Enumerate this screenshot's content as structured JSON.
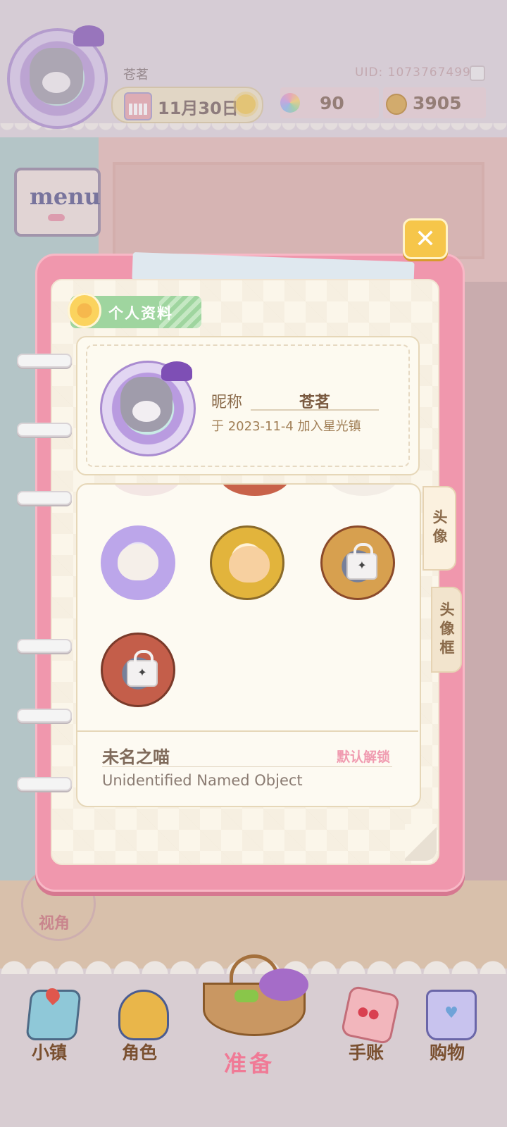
{
  "top_bar": {
    "player_name": "苍茗",
    "date": "11月30日",
    "uid": "UID: 1073767499",
    "gems": "90",
    "coins": "3905"
  },
  "menu": {
    "label": "menu"
  },
  "close": {
    "label": "✕"
  },
  "background": {
    "view_label": "视角"
  },
  "dialog": {
    "title": "个人资料",
    "profile": {
      "nickname_label": "昵称",
      "nickname_value": "苍茗",
      "joined": "于 2023-11-4 加入星光镇"
    },
    "avatars": [
      {
        "name": "avatar-option-1",
        "locked": false
      },
      {
        "name": "avatar-option-2",
        "locked": false
      },
      {
        "name": "avatar-option-3",
        "locked": true
      },
      {
        "name": "avatar-option-4",
        "locked": true
      }
    ],
    "detail": {
      "avatar_name": "未名之喵",
      "unlock_status": "默认解锁",
      "description": "Unidentified Named Object"
    },
    "side_tabs": {
      "avatar": "头像",
      "frame": "头像框"
    }
  },
  "bottom_nav": {
    "items": [
      {
        "label": "小镇",
        "icon": "map-icon"
      },
      {
        "label": "角色",
        "icon": "character-icon"
      },
      {
        "label": "准备",
        "icon": "basket-icon"
      },
      {
        "label": "手账",
        "icon": "journal-icon"
      },
      {
        "label": "购物",
        "icon": "shopping-bag-icon"
      }
    ]
  }
}
